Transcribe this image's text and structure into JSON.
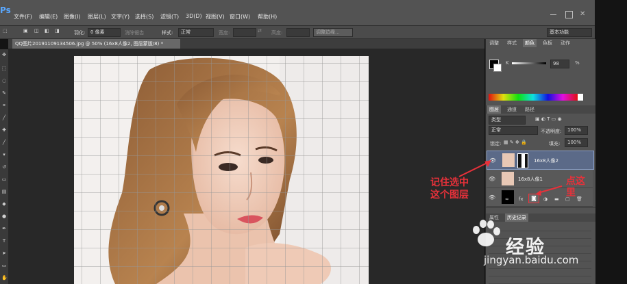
{
  "app": {
    "logo_text": "Ps"
  },
  "menu": [
    "文件(F)",
    "编辑(E)",
    "图像(I)",
    "图层(L)",
    "文字(Y)",
    "选择(S)",
    "滤镜(T)",
    "3D(D)",
    "视图(V)",
    "窗口(W)",
    "帮助(H)"
  ],
  "options_bar": {
    "feather_label": "羽化:",
    "feather_value": "0 像素",
    "antialias_label": "消除锯齿",
    "style_label": "样式:",
    "style_value": "正常",
    "width_label": "宽度:",
    "height_label": "高度:",
    "refine_edge_button": "调整边缘...",
    "workspace_value": "基本功能"
  },
  "document_tab": {
    "title": "QQ图片20191109134506.jpg @ 50% (16x8人像2, 图层蒙版/8) *"
  },
  "panels": {
    "top_tabs": [
      "调整",
      "样式",
      "颜色",
      "色板",
      "动作"
    ],
    "color": {
      "channel_label": "K",
      "value": "98",
      "unit": "%"
    },
    "layers_tabs": [
      "图层",
      "通道",
      "路径"
    ],
    "kind_filter": "类型",
    "blend_mode": "正常",
    "opacity_label": "不透明度:",
    "opacity_value": "100%",
    "lock_label": "锁定:",
    "fill_label": "填充:",
    "fill_value": "100%",
    "layers": [
      {
        "name": "16x8人像2"
      },
      {
        "name": "16x8人像1"
      },
      {
        "name": ""
      }
    ],
    "history_tabs": [
      "属性",
      "历史记录"
    ]
  },
  "annotations": {
    "left_line1": "记住选中",
    "left_line2": "这个图层",
    "right_line1": "点这",
    "right_line2": "里"
  },
  "watermark": {
    "brand_text": "经验",
    "url": "jingyan.baidu.com"
  },
  "colors": {
    "annotation_red": "#e8313a",
    "selection_blue": "#5b6a88"
  }
}
